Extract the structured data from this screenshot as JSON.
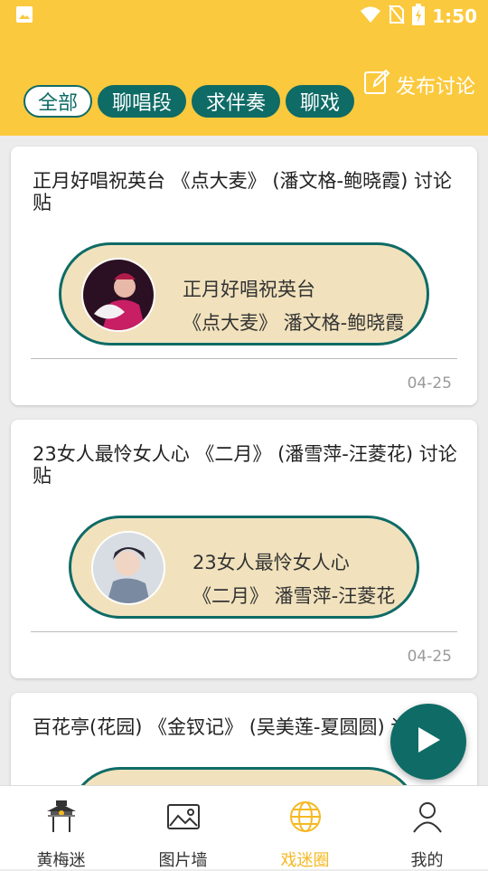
{
  "status_bar": {
    "time": "1:50"
  },
  "header": {
    "filters": [
      "全部",
      "聊唱段",
      "求伴奏",
      "聊戏"
    ],
    "active_filter_index": 0,
    "publish_label": "发布讨论"
  },
  "posts": [
    {
      "title": "正月好唱祝英台 《点大麦》 (潘文格-鲍晓霞) 讨论贴",
      "card_line1": "正月好唱祝英台",
      "card_line2": "《点大麦》 潘文格-鲍晓霞",
      "date": "04-25"
    },
    {
      "title": "23女人最怜女人心 《二月》 (潘雪萍-汪菱花) 讨论贴",
      "card_line1": "23女人最怜女人心",
      "card_line2": "《二月》 潘雪萍-汪菱花",
      "date": "04-25"
    },
    {
      "title": "百花亭(花园) 《金钗记》 (吴美莲-夏圆圆) 讨"
    }
  ],
  "tabs": [
    {
      "label": "黄梅迷",
      "icon": "pavilion-icon"
    },
    {
      "label": "图片墙",
      "icon": "image-icon"
    },
    {
      "label": "戏迷圈",
      "icon": "globe-icon"
    },
    {
      "label": "我的",
      "icon": "person-icon"
    }
  ],
  "colors": {
    "accent": "#fbc93d",
    "teal": "#0f6b66",
    "pill_bg": "#f1e2bd",
    "active_tab": "#f5b922"
  }
}
